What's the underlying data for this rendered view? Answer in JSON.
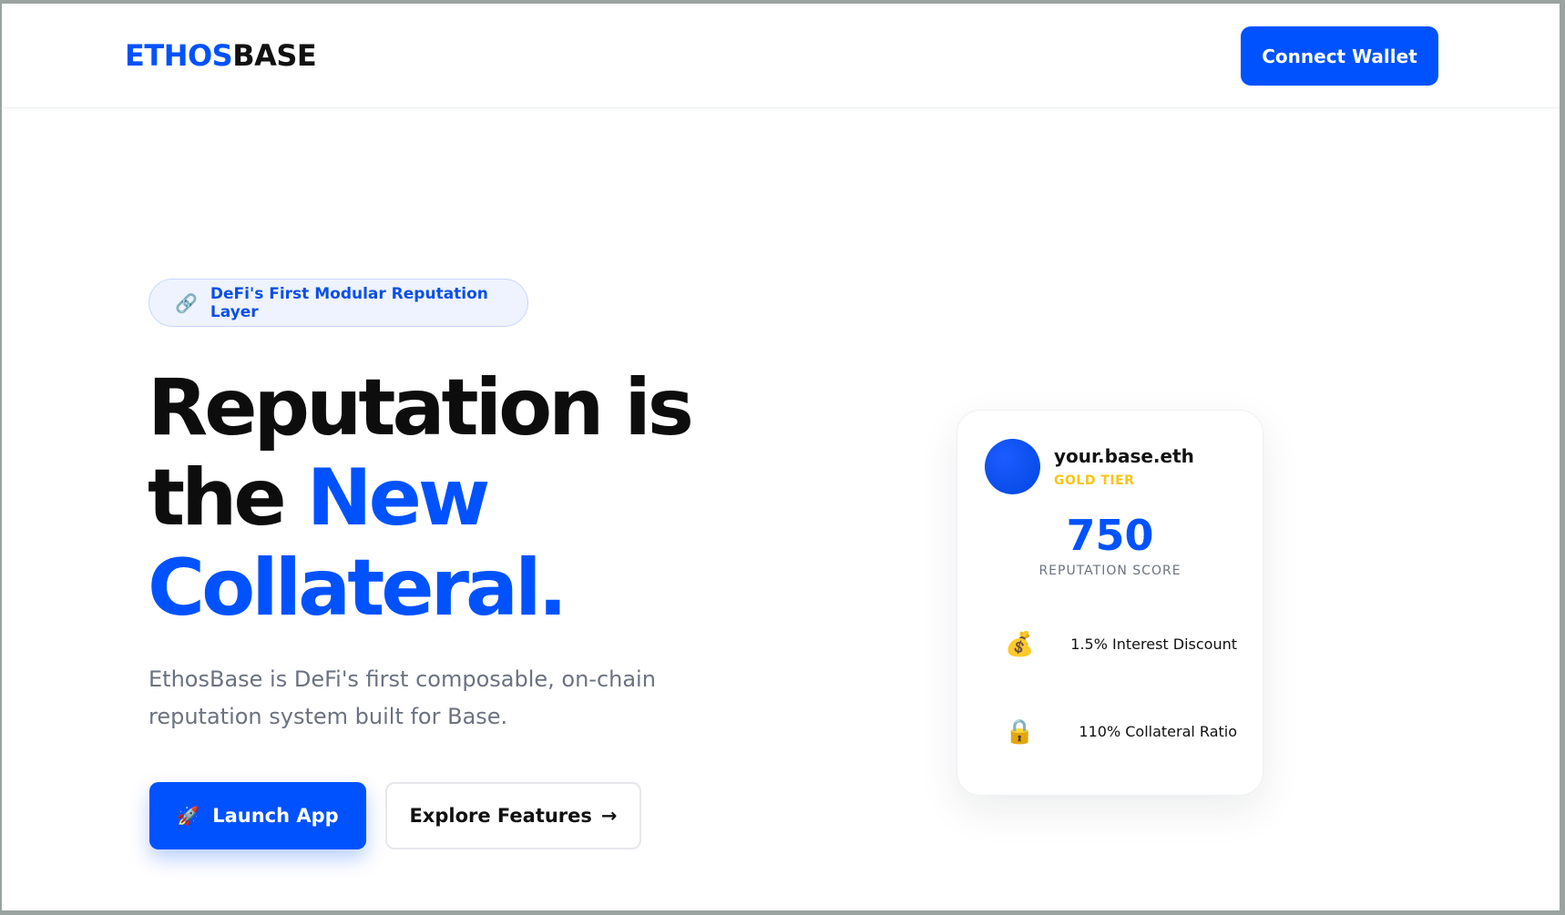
{
  "brand": {
    "part1": "ETHOS",
    "part2": "BASE"
  },
  "nav": {
    "connect_label": "Connect Wallet"
  },
  "hero": {
    "badge_icon": "🔗",
    "badge_text": "DeFi's First Modular Reputation Layer",
    "headline_line1": "Reputation is",
    "headline_line2_plain": "the ",
    "headline_line2_blue": "New",
    "headline_line3": "Collateral.",
    "subtitle": "EthosBase is DeFi's first composable, on-chain reputation system built for Base.",
    "launch_icon": "🚀",
    "launch_label": "Launch App",
    "explore_label": "Explore Features",
    "explore_arrow": "→"
  },
  "card": {
    "name": "your.base.eth",
    "tier": "GOLD TIER",
    "score": "750",
    "score_label": "REPUTATION SCORE",
    "perks": [
      {
        "icon": "💰",
        "text": "1.5% Interest Discount"
      },
      {
        "icon": "🔒",
        "text": "110% Collateral Ratio"
      }
    ]
  },
  "colors": {
    "accent": "#0052ff",
    "tier_gold": "#f5c518",
    "text_dark": "#0d0d0d",
    "text_muted": "#6b7280"
  }
}
